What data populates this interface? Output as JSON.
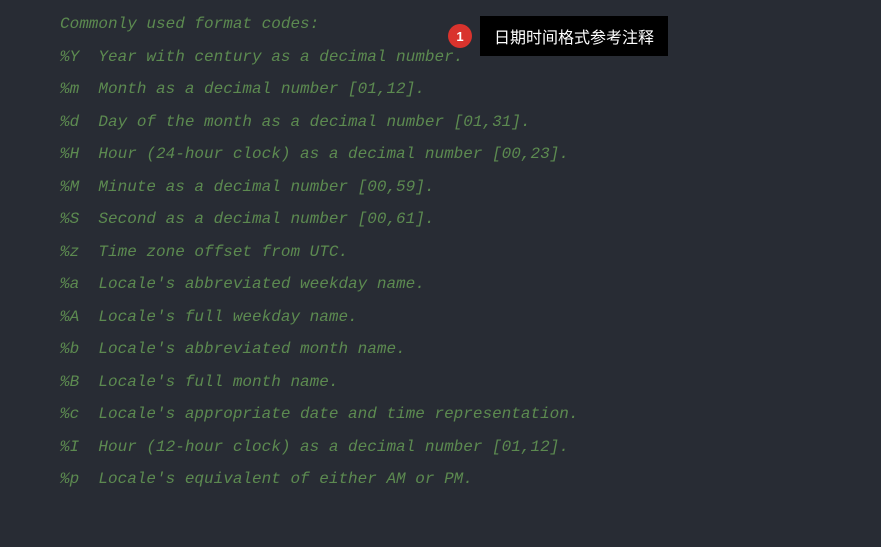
{
  "code": {
    "header": "Commonly used format codes:",
    "blank": "",
    "lines": [
      "%Y  Year with century as a decimal number.",
      "%m  Month as a decimal number [01,12].",
      "%d  Day of the month as a decimal number [01,31].",
      "%H  Hour (24-hour clock) as a decimal number [00,23].",
      "%M  Minute as a decimal number [00,59].",
      "%S  Second as a decimal number [00,61].",
      "%z  Time zone offset from UTC.",
      "%a  Locale's abbreviated weekday name.",
      "%A  Locale's full weekday name.",
      "%b  Locale's abbreviated month name.",
      "%B  Locale's full month name.",
      "%c  Locale's appropriate date and time representation.",
      "%I  Hour (12-hour clock) as a decimal number [01,12].",
      "%p  Locale's equivalent of either AM or PM."
    ]
  },
  "annotation": {
    "number": "1",
    "label": "日期时间格式参考注释"
  }
}
